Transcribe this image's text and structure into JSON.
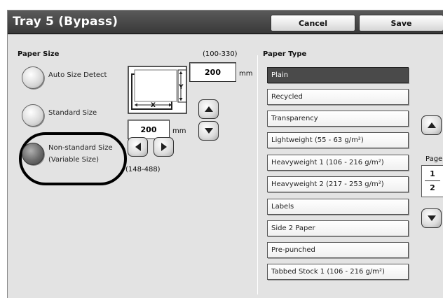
{
  "header": {
    "title": "Tray 5 (Bypass)",
    "cancel_label": "Cancel",
    "save_label": "Save"
  },
  "paper_size": {
    "heading": "Paper Size",
    "options": [
      {
        "label": "Auto Size Detect",
        "selected": false
      },
      {
        "label": "Standard Size",
        "selected": false
      },
      {
        "label_line1": "Non-standard Size",
        "label_line2": "(Variable Size)",
        "selected": true
      }
    ],
    "y_range": "(100-330)",
    "y_value": "200",
    "y_unit": "mm",
    "x_value": "200",
    "x_unit": "mm",
    "x_range": "(148-488)",
    "diagram_x": "X",
    "diagram_y": "Y"
  },
  "paper_type": {
    "heading": "Paper Type",
    "items": [
      {
        "label": "Plain",
        "selected": true
      },
      {
        "label": "Recycled",
        "selected": false
      },
      {
        "label": "Transparency",
        "selected": false
      },
      {
        "label": "Lightweight (55 - 63 g/m²)",
        "selected": false
      },
      {
        "label": "Heavyweight 1 (106 - 216 g/m²)",
        "selected": false
      },
      {
        "label": "Heavyweight 2 (217 - 253 g/m²)",
        "selected": false
      },
      {
        "label": "Labels",
        "selected": false
      },
      {
        "label": "Side 2 Paper",
        "selected": false
      },
      {
        "label": "Pre-punched",
        "selected": false
      },
      {
        "label": "Tabbed Stock 1 (106 - 216 g/m²)",
        "selected": false
      }
    ]
  },
  "pager": {
    "label": "Page",
    "current": "1",
    "total": "2"
  },
  "colors": {
    "header_bg": "#4a4a4a",
    "panel_bg": "#e3e3e3",
    "selected_item": "#4a4a4a"
  }
}
